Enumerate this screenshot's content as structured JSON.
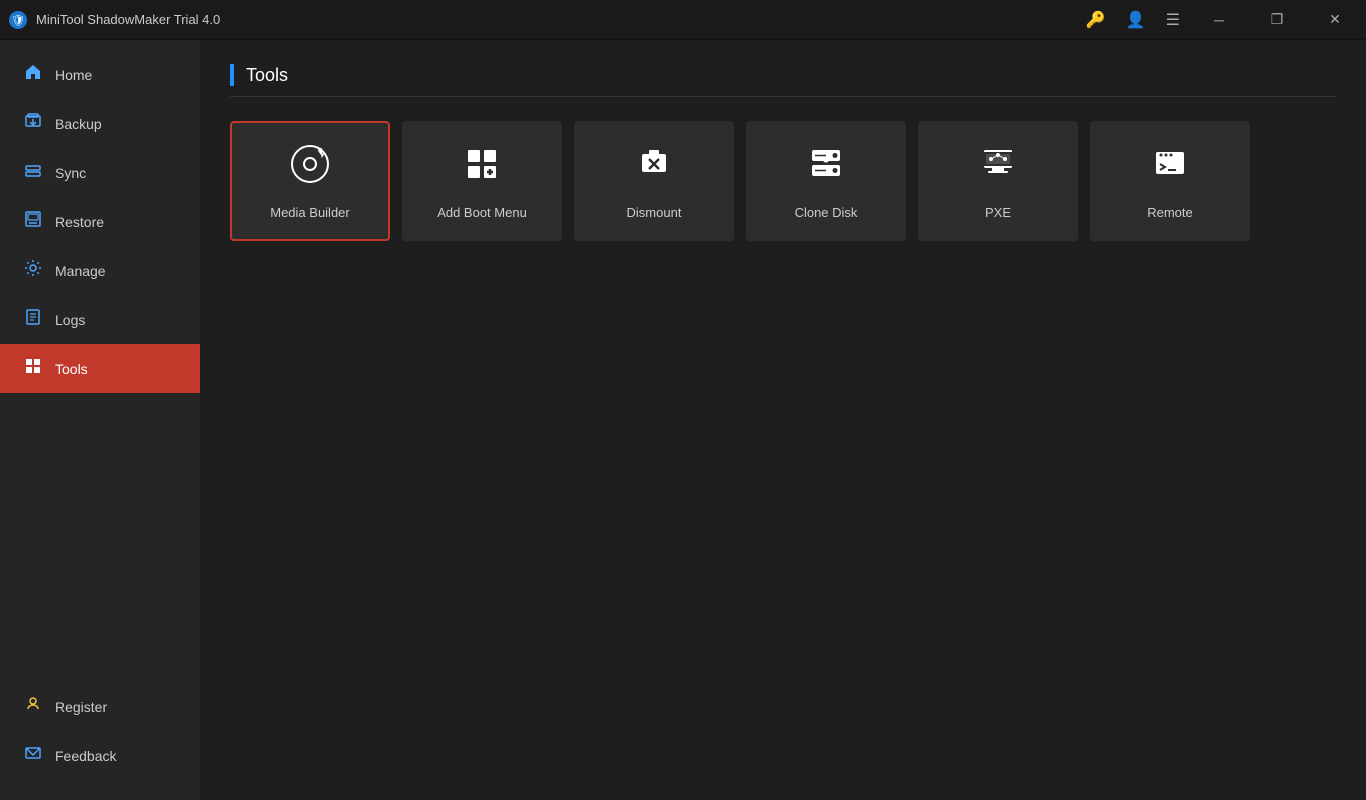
{
  "app": {
    "title": "MiniTool ShadowMaker Trial 4.0"
  },
  "titlebar": {
    "icons": {
      "key": "🔑",
      "person": "👤",
      "menu": "☰"
    },
    "minimize": "─",
    "restore": "❐",
    "close": "✕"
  },
  "sidebar": {
    "items": [
      {
        "id": "home",
        "label": "Home",
        "icon": "🏠"
      },
      {
        "id": "backup",
        "label": "Backup",
        "icon": "💾"
      },
      {
        "id": "sync",
        "label": "Sync",
        "icon": "🔄"
      },
      {
        "id": "restore",
        "label": "Restore",
        "icon": "🖥"
      },
      {
        "id": "manage",
        "label": "Manage",
        "icon": "⚙"
      },
      {
        "id": "logs",
        "label": "Logs",
        "icon": "📋"
      },
      {
        "id": "tools",
        "label": "Tools",
        "icon": "⊞",
        "active": true
      }
    ],
    "bottom": [
      {
        "id": "register",
        "label": "Register",
        "icon": "🔑"
      },
      {
        "id": "feedback",
        "label": "Feedback",
        "icon": "✉"
      }
    ]
  },
  "main": {
    "page_title": "Tools",
    "tools": [
      {
        "id": "media-builder",
        "label": "Media Builder",
        "selected": true
      },
      {
        "id": "add-boot-menu",
        "label": "Add Boot Menu",
        "selected": false
      },
      {
        "id": "dismount",
        "label": "Dismount",
        "selected": false
      },
      {
        "id": "clone-disk",
        "label": "Clone Disk",
        "selected": false
      },
      {
        "id": "pxe",
        "label": "PXE",
        "selected": false
      },
      {
        "id": "remote",
        "label": "Remote",
        "selected": false
      }
    ]
  }
}
